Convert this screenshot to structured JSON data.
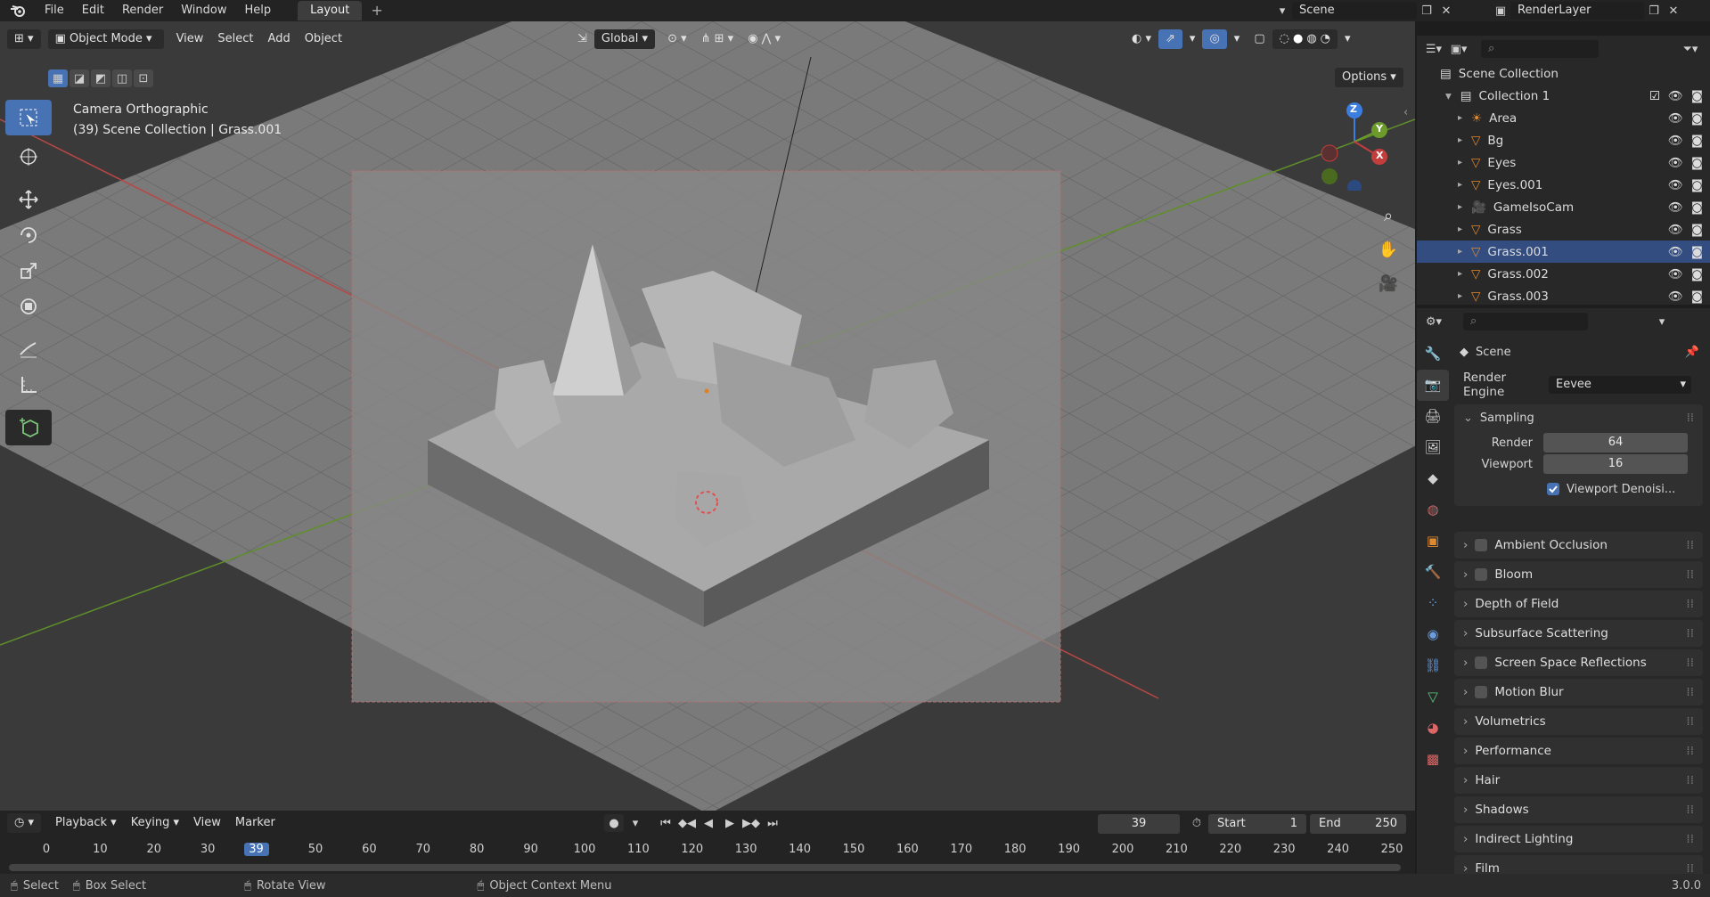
{
  "app": {
    "version": "3.0.0"
  },
  "topbar": {
    "menus": [
      "File",
      "Edit",
      "Render",
      "Window",
      "Help"
    ],
    "workspace_tab": "Layout",
    "add_tab": "+",
    "scene": "Scene",
    "view_layer": "RenderLayer"
  },
  "viewport": {
    "mode": "Object Mode",
    "menus": [
      "View",
      "Select",
      "Add",
      "Object"
    ],
    "transform_orientation": "Global",
    "options_label": "Options",
    "info_line1": "Camera Orthographic",
    "info_line2": "(39) Scene Collection | Grass.001",
    "gizmo": {
      "x": "X",
      "y": "Y",
      "z": "Z"
    }
  },
  "outliner": {
    "root": "Scene Collection",
    "collection": "Collection 1",
    "items": [
      {
        "name": "Area",
        "icon": "light-icon"
      },
      {
        "name": "Bg",
        "icon": "mesh-icon"
      },
      {
        "name": "Eyes",
        "icon": "mesh-icon"
      },
      {
        "name": "Eyes.001",
        "icon": "mesh-icon"
      },
      {
        "name": "GameIsoCam",
        "icon": "camera-icon"
      },
      {
        "name": "Grass",
        "icon": "mesh-icon"
      },
      {
        "name": "Grass.001",
        "icon": "mesh-icon"
      },
      {
        "name": "Grass.002",
        "icon": "mesh-icon"
      },
      {
        "name": "Grass.003",
        "icon": "mesh-icon"
      }
    ]
  },
  "properties": {
    "context": "Scene",
    "render_engine_label": "Render Engine",
    "render_engine": "Eevee",
    "sampling": {
      "title": "Sampling",
      "render_label": "Render",
      "render_value": "64",
      "viewport_label": "Viewport",
      "viewport_value": "16",
      "denoise_label": "Viewport Denoisi..."
    },
    "panels": [
      {
        "label": "Ambient Occlusion",
        "checkbox": true
      },
      {
        "label": "Bloom",
        "checkbox": true
      },
      {
        "label": "Depth of Field",
        "checkbox": false
      },
      {
        "label": "Subsurface Scattering",
        "checkbox": false
      },
      {
        "label": "Screen Space Reflections",
        "checkbox": true
      },
      {
        "label": "Motion Blur",
        "checkbox": true
      },
      {
        "label": "Volumetrics",
        "checkbox": false
      },
      {
        "label": "Performance",
        "checkbox": false
      },
      {
        "label": "Hair",
        "checkbox": false
      },
      {
        "label": "Shadows",
        "checkbox": false
      },
      {
        "label": "Indirect Lighting",
        "checkbox": false
      },
      {
        "label": "Film",
        "checkbox": false
      }
    ]
  },
  "timeline": {
    "menus": [
      "Playback",
      "Keying",
      "View",
      "Marker"
    ],
    "current_frame": "39",
    "start_label": "Start",
    "start": "1",
    "end_label": "End",
    "end": "250",
    "ticks": [
      "0",
      "10",
      "20",
      "30",
      "39",
      "50",
      "60",
      "70",
      "80",
      "90",
      "100",
      "110",
      "120",
      "130",
      "140",
      "150",
      "160",
      "170",
      "180",
      "190",
      "200",
      "210",
      "220",
      "230",
      "240",
      "250"
    ]
  },
  "statusbar": {
    "select": "Select",
    "box_select": "Box Select",
    "rotate_view": "Rotate View",
    "context_menu": "Object Context Menu",
    "version": "3.0.0"
  },
  "colors": {
    "accent": "#4772b3",
    "selected_row": "#334d80",
    "axis_x": "#c33d3d",
    "axis_y": "#6c9a2b",
    "axis_z": "#3c7de0"
  }
}
